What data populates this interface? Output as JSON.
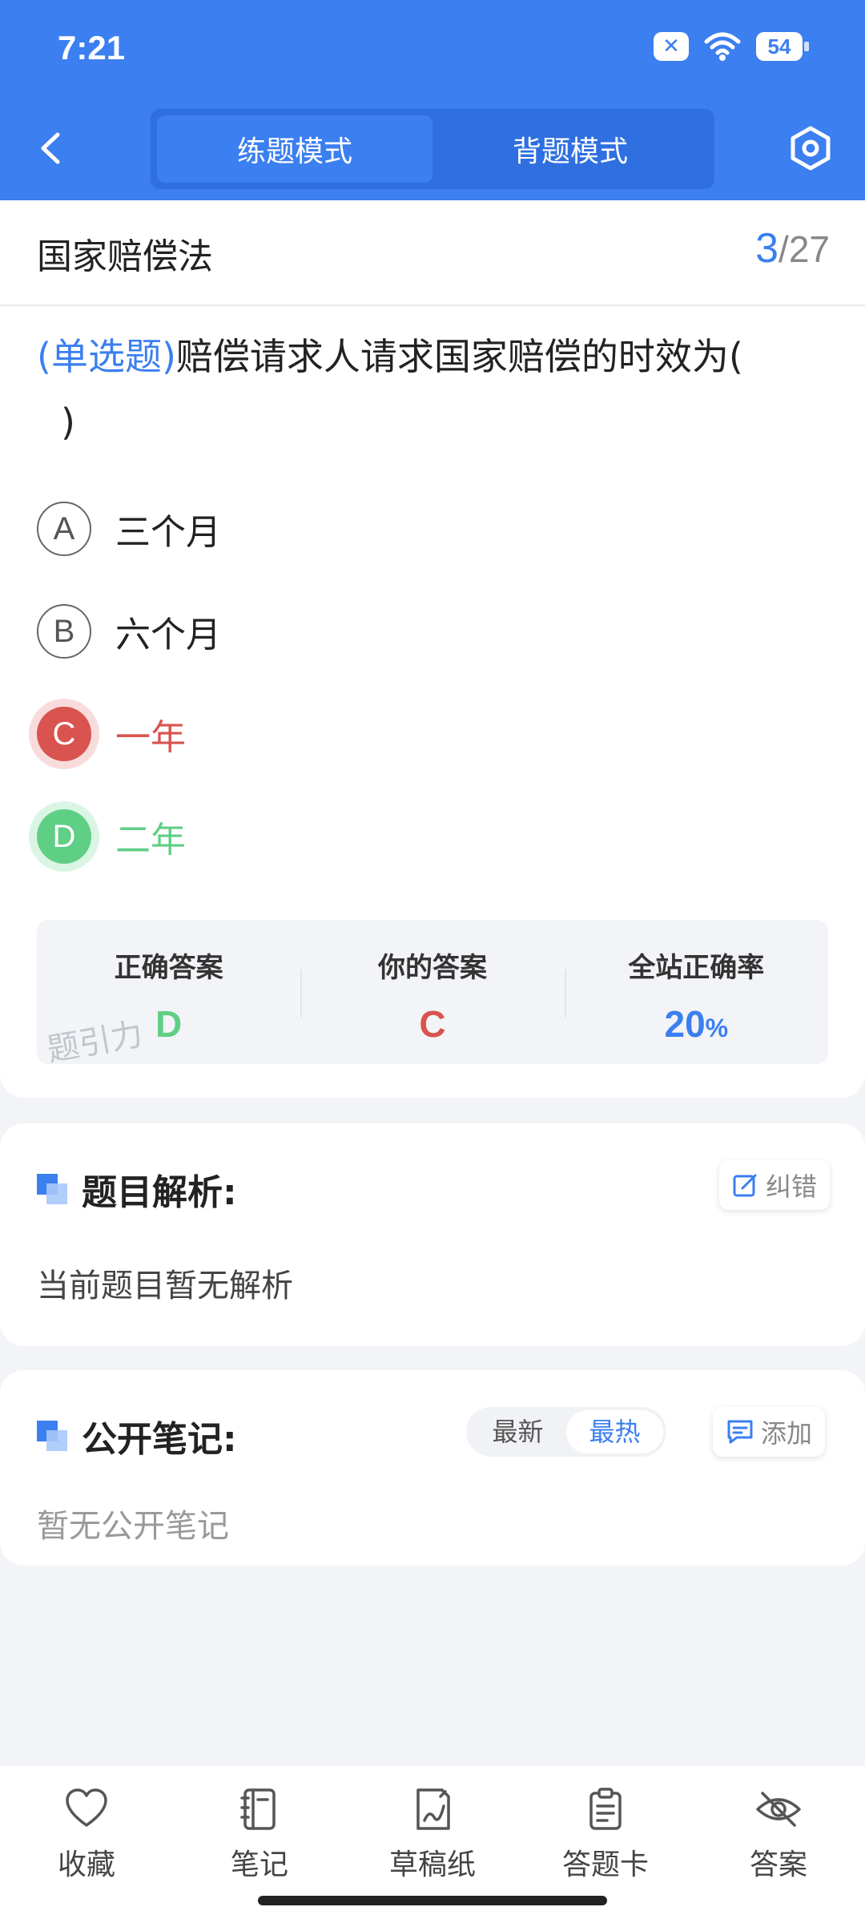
{
  "status_bar": {
    "time": "7:21",
    "notification_badge": "✕",
    "battery": "54"
  },
  "header": {
    "modes": [
      {
        "label": "练题模式",
        "active": true
      },
      {
        "label": "背题模式",
        "active": false
      }
    ]
  },
  "subject": {
    "title": "国家赔偿法",
    "current": "3",
    "separator": "/",
    "total": "27"
  },
  "question": {
    "type": "(单选题)",
    "text": "赔偿请求人请求国家赔偿的时效为(",
    "text_line2": ")"
  },
  "options": [
    {
      "letter": "A",
      "text": "三个月"
    },
    {
      "letter": "B",
      "text": "六个月"
    },
    {
      "letter": "C",
      "text": "一年"
    },
    {
      "letter": "D",
      "text": "二年"
    }
  ],
  "answer_summary": {
    "correct_label": "正确答案",
    "correct_value": "D",
    "yours_label": "你的答案",
    "yours_value": "C",
    "rate_label": "全站正确率",
    "rate_value": "20",
    "rate_unit": "%",
    "watermark": "题引力"
  },
  "analysis": {
    "title": "题目解析:",
    "report_label": "纠错",
    "body": "当前题目暂无解析"
  },
  "notes": {
    "title": "公开笔记:",
    "sort_options": [
      "最新",
      "最热"
    ],
    "sort_active": "最热",
    "add_label": "添加",
    "empty": "暂无公开笔记"
  },
  "bottom_nav": [
    {
      "label": "收藏",
      "icon": "heart-icon"
    },
    {
      "label": "笔记",
      "icon": "notebook-icon"
    },
    {
      "label": "草稿纸",
      "icon": "draft-icon"
    },
    {
      "label": "答题卡",
      "icon": "answer-sheet-icon"
    },
    {
      "label": "答案",
      "icon": "eye-off-icon"
    }
  ],
  "colors": {
    "primary": "#3b7ff0",
    "wrong": "#d9534f",
    "correct": "#5fcf86",
    "background": "#f3f4f7"
  }
}
